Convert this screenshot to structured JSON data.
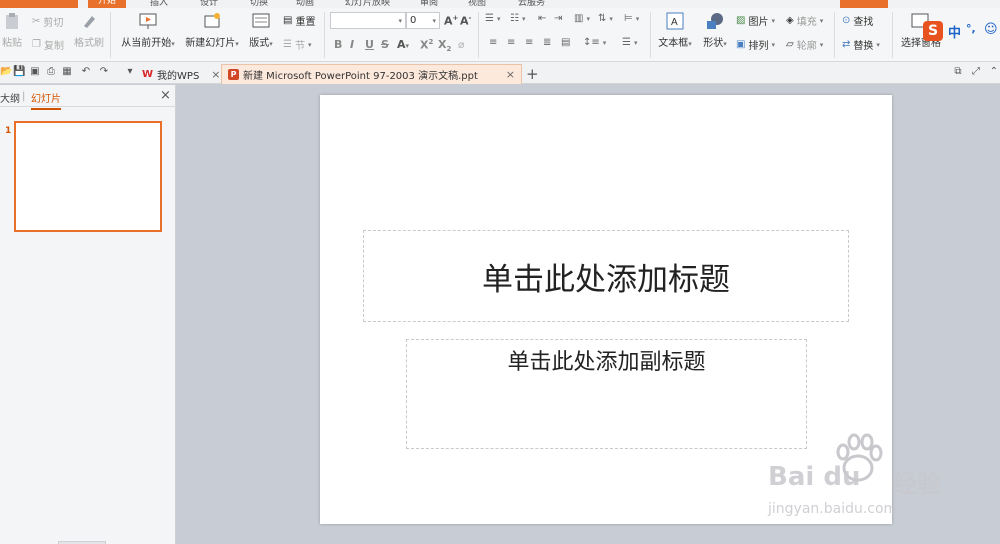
{
  "menubar": {
    "tabs": [
      "开始",
      "插入",
      "设计",
      "切换",
      "动画",
      "幻灯片放映",
      "审阅",
      "视图",
      "云服务"
    ]
  },
  "ribbon": {
    "paste": "粘贴",
    "cut": "剪切",
    "copy": "复制",
    "format_painter": "格式刷",
    "from_current": "从当前开始",
    "new_slide": "新建幻灯片",
    "layout": "版式",
    "reset": "重置",
    "section": "节",
    "font_size": "0",
    "text_box": "文本框",
    "shape": "形状",
    "picture": "图片",
    "fill": "填充",
    "arrange": "排列",
    "outline": "轮廓",
    "find": "查找",
    "replace": "替换",
    "select_pane": "选择窗格",
    "ime_mode": "中",
    "ime_punct": "°,"
  },
  "tabbar": {
    "home_tab": "我的WPS",
    "doc_tab": "新建 Microsoft PowerPoint 97-2003 演示文稿.ppt"
  },
  "leftpane": {
    "outline_tab": "大纲",
    "slides_tab": "幻灯片",
    "slide_number": "1"
  },
  "slide": {
    "title_placeholder": "单击此处添加标题",
    "subtitle_placeholder": "单击此处添加副标题"
  },
  "watermark": {
    "brand": "Bai du",
    "jingyan": "经验",
    "url": "jingyan.baidu.com"
  },
  "colors": {
    "accent": "#e8702a",
    "slide_bg": "#ffffff",
    "workspace": "#c8ccd4"
  }
}
